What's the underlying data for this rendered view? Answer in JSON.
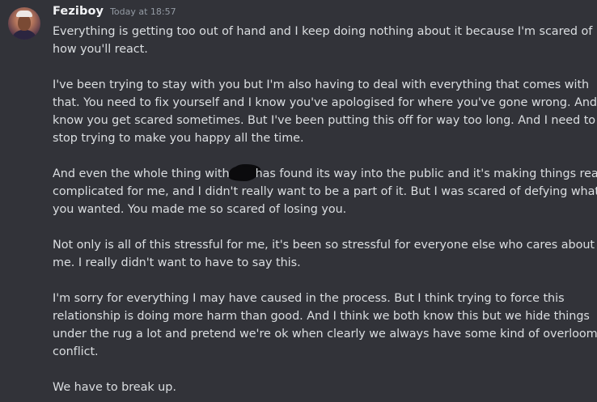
{
  "message": {
    "username": "Feziboy",
    "timestamp": "Today at 18:57",
    "paragraphs": [
      {
        "lines": [
          "Everything is getting too out of hand and I keep doing nothing about it because I'm scared of",
          "how you'll react."
        ]
      },
      {
        "lines": [
          "I've been trying to stay with you but I'm also having to deal with everything that comes with",
          "that. You need to fix yourself and I know you've apologised for where you've gone wrong. And I",
          "know you get scared sometimes. But I've been putting this off for way too long. And I need to",
          "stop trying to make you happy all the time."
        ]
      },
      {
        "lines": [
          "And even the whole thing with",
          "has found its way into the public and it's making things really",
          "complicated for me, and I didn't really want to be a part of it. But I was scared of defying what",
          "you wanted. You made me so scared of losing you."
        ]
      },
      {
        "lines": [
          "Not only is all of this stressful for me, it's been so stressful for everyone else who cares about",
          "me. I really didn't want to have to say this."
        ]
      },
      {
        "lines": [
          "I'm sorry for everything I may have caused in the process. But I think trying to force this",
          "relationship is doing more harm than good. And I think we both know this but we hide things",
          "under the rug a lot and pretend we're ok when clearly we always have some kind of overlooming",
          "conflict."
        ]
      },
      {
        "lines": [
          "We have to break up."
        ]
      }
    ]
  }
}
